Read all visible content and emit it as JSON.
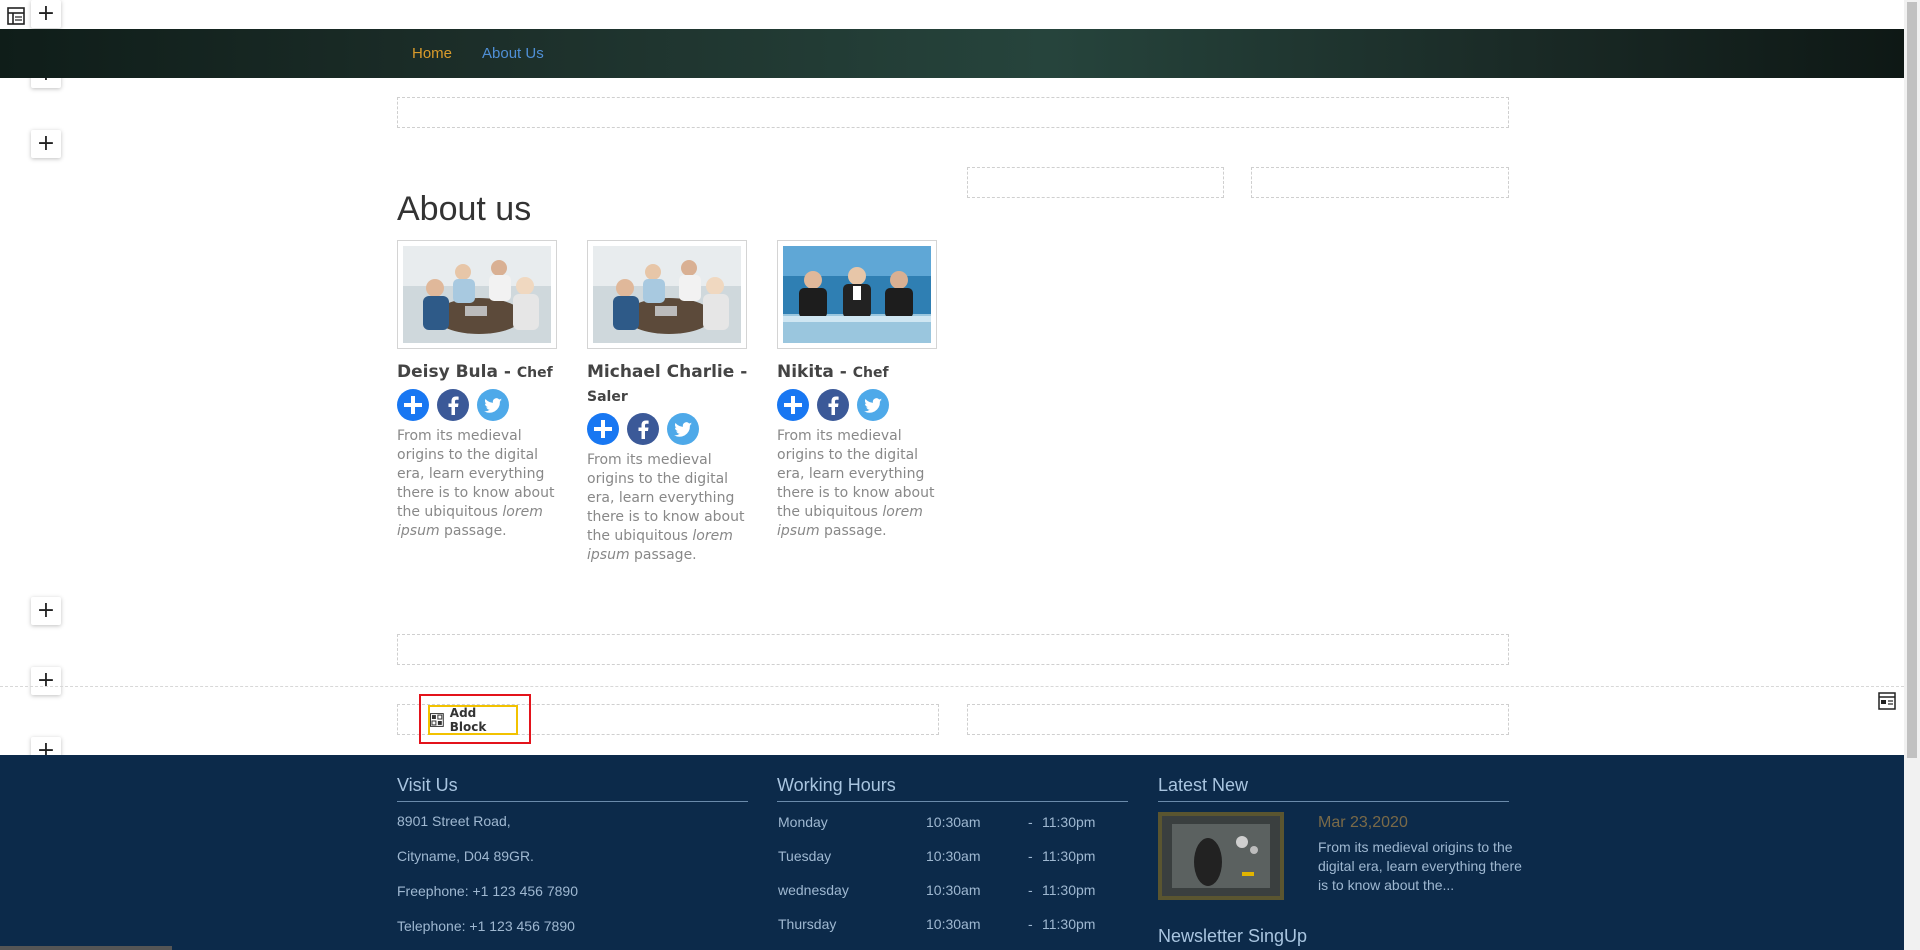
{
  "nav": {
    "home_label": "Home",
    "about_label": "About Us"
  },
  "page": {
    "title": "About us"
  },
  "team": [
    {
      "name": "Deisy Bula",
      "separator": " - ",
      "role": "Chef",
      "bio_pre": "From its medieval origins to the digital era, learn everything there is to know about the ubiquitous ",
      "bio_em": "lorem ipsum",
      "bio_post": " passage."
    },
    {
      "name": "Michael Charlie",
      "separator": " - ",
      "role": "Saler",
      "bio_pre": "From its medieval origins to the digital era, learn everything there is to know about the ubiquitous ",
      "bio_em": "lorem ipsum",
      "bio_post": " passage."
    },
    {
      "name": "Nikita",
      "separator": " - ",
      "role": "Chef",
      "bio_pre": "From its medieval origins to the digital era, learn everything there is to know about the ubiquitous ",
      "bio_em": "lorem ipsum",
      "bio_post": " passage."
    }
  ],
  "editor": {
    "add_block_label": "Add Block"
  },
  "footer": {
    "visit": {
      "heading": "Visit Us",
      "address1": "8901 Street Road,",
      "address2": "Cityname, D04 89GR.",
      "freephone": "Freephone: +1 123 456 7890",
      "telephone": "Telephone: +1 123 456 7890"
    },
    "hours": {
      "heading": "Working Hours",
      "rows": [
        {
          "day": "Monday",
          "open": "10:30am",
          "dash": "-",
          "close": "11:30pm"
        },
        {
          "day": "Tuesday",
          "open": "10:30am",
          "dash": "-",
          "close": "11:30pm"
        },
        {
          "day": "wednesday",
          "open": "10:30am",
          "dash": "-",
          "close": "11:30pm"
        },
        {
          "day": "Thursday",
          "open": "10:30am",
          "dash": "-",
          "close": "11:30pm"
        }
      ]
    },
    "news": {
      "heading": "Latest New",
      "date": "Mar 23,2020",
      "excerpt": "From its medieval origins to the digital era, learn everything there is to know about the..."
    },
    "newsletter": {
      "heading": "Newsletter SingUp"
    }
  },
  "colors": {
    "nav_home": "#d99b2b",
    "nav_link": "#4f8fd6",
    "footer_bg": "#0c2a4a",
    "highlight_outline": "#e3131b",
    "add_block_border": "#f2c200"
  }
}
